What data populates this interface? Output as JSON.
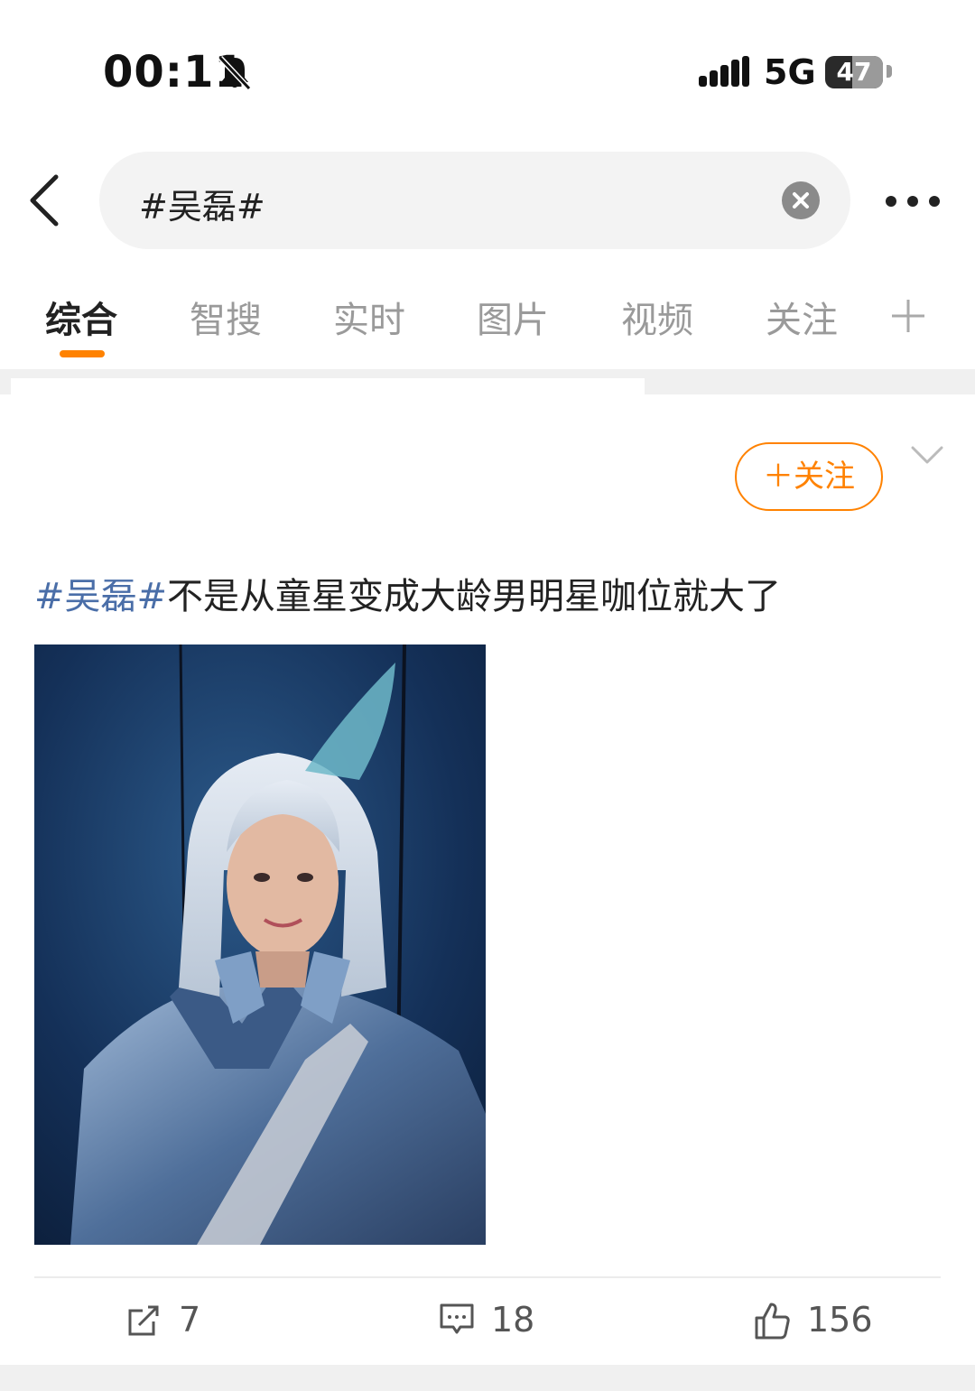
{
  "status_bar": {
    "time": "00:11",
    "network": "5G",
    "battery_level": 47,
    "battery_text": "47"
  },
  "search": {
    "query": "#吴磊#"
  },
  "tabs": [
    {
      "label": "综合",
      "active": true
    },
    {
      "label": "智搜",
      "active": false
    },
    {
      "label": "实时",
      "active": false
    },
    {
      "label": "图片",
      "active": false
    },
    {
      "label": "视频",
      "active": false
    },
    {
      "label": "关注",
      "active": false
    }
  ],
  "post": {
    "follow_label": "＋关注",
    "hashtag": "#吴磊#",
    "text": "不是从童星变成大龄男明星咖位就大了",
    "actions": {
      "repost_count": "7",
      "comment_count": "18",
      "like_count": "156"
    }
  },
  "colors": {
    "accent": "#ff8200",
    "hashtag": "#4a6ea8"
  }
}
